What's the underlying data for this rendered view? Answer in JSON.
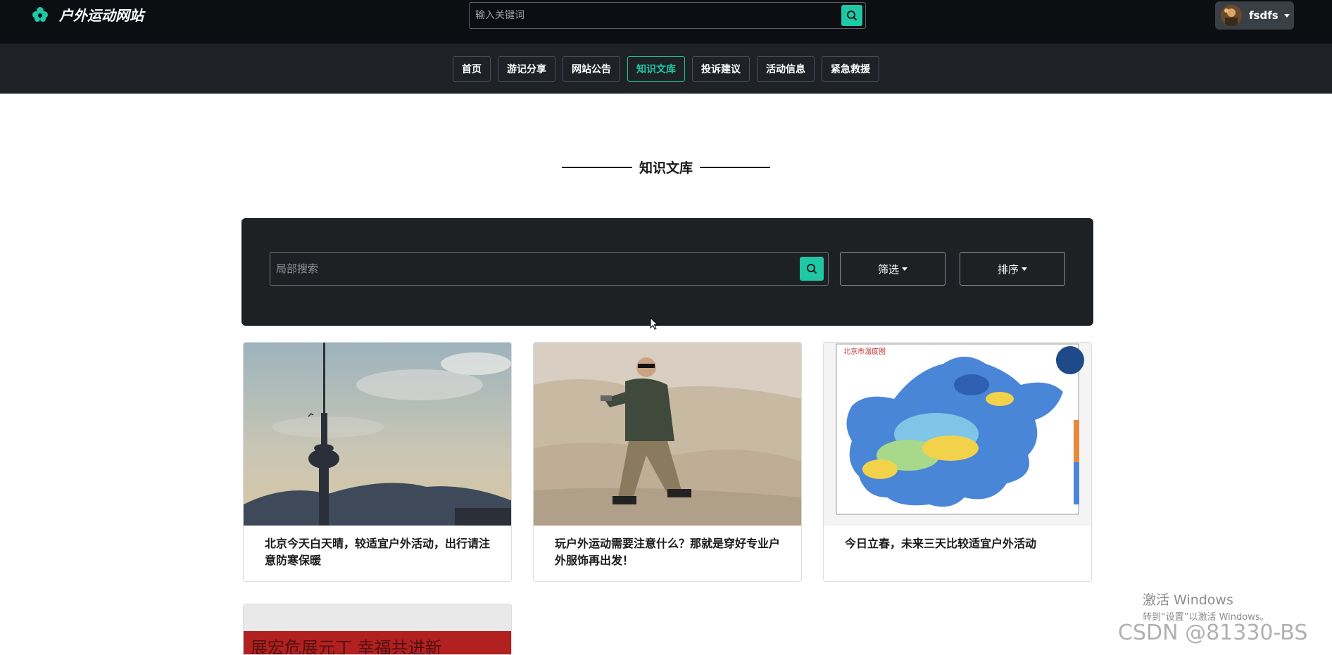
{
  "header": {
    "site_name": "户外运动网站",
    "search_placeholder": "输入关键词",
    "username": "fsdfs"
  },
  "nav": {
    "items": [
      {
        "label": "首页",
        "active": false
      },
      {
        "label": "游记分享",
        "active": false
      },
      {
        "label": "网站公告",
        "active": false
      },
      {
        "label": "知识文库",
        "active": true
      },
      {
        "label": "投诉建议",
        "active": false
      },
      {
        "label": "活动信息",
        "active": false
      },
      {
        "label": "紧急救援",
        "active": false
      }
    ]
  },
  "page": {
    "title": "知识文库"
  },
  "filter": {
    "search_placeholder": "局部搜索",
    "filter_label": "筛选",
    "sort_label": "排序"
  },
  "articles": [
    {
      "title": "北京今天白天晴，较适宜户外活动，出行请注意防寒保暖"
    },
    {
      "title": "玩户外运动需要注意什么？那就是穿好专业户外服饰再出发！"
    },
    {
      "title": "今日立春，未来三天比较适宜户外活动"
    }
  ],
  "overlay": {
    "activate_title": "激活 Windows",
    "activate_sub": "转到“设置”以激活 Windows。",
    "csdn": "CSDN @81330-BS"
  },
  "colors": {
    "accent": "#1ec8a5",
    "topbar": "#0c0e12",
    "navbar": "#1e2226"
  }
}
